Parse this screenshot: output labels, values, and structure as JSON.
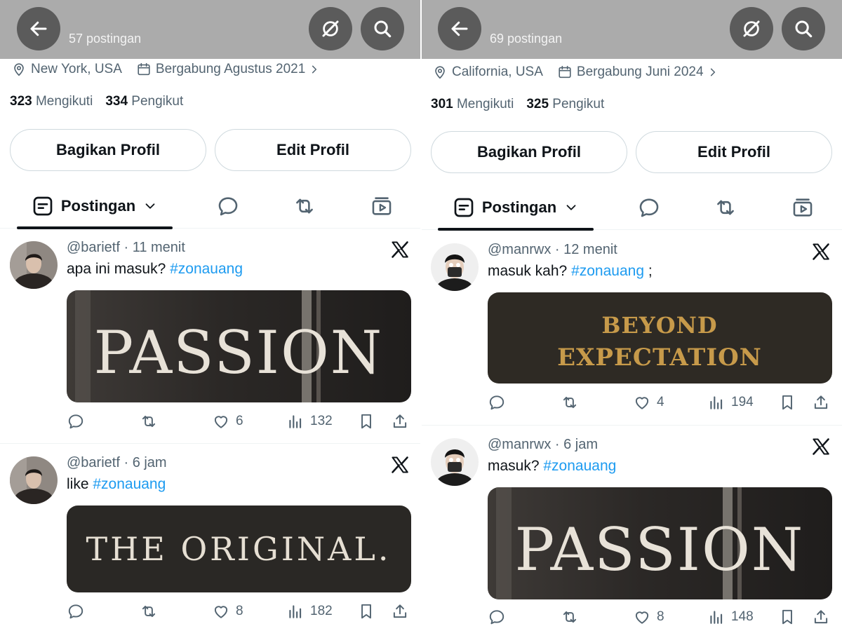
{
  "panels": [
    {
      "header": {
        "post_count": "57 postingan"
      },
      "profile": {
        "location": "New York, USA",
        "joined": "Bergabung Agustus 2021",
        "following_count": "323",
        "following_label": "Mengikuti",
        "followers_count": "334",
        "followers_label": "Pengikut"
      },
      "buttons": {
        "share": "Bagikan Profil",
        "edit": "Edit Profil"
      },
      "tabs": {
        "posts": "Postingan"
      },
      "posts": [
        {
          "handle": "@barietf",
          "sep": "·",
          "time": "11 menit",
          "text": "apa ini masuk? ",
          "hashtag": "#zonauang",
          "suffix": "",
          "image_text": "PASSION",
          "likes": "6",
          "views": "132"
        },
        {
          "handle": "@barietf",
          "sep": "·",
          "time": "6 jam",
          "text": "like ",
          "hashtag": "#zonauang",
          "suffix": "",
          "image_text": "THE ORIGINAL.",
          "likes": "8",
          "views": "182"
        }
      ]
    },
    {
      "header": {
        "post_count": "69 postingan"
      },
      "profile": {
        "location": "California, USA",
        "joined": "Bergabung Juni 2024",
        "following_count": "301",
        "following_label": "Mengikuti",
        "followers_count": "325",
        "followers_label": "Pengikut"
      },
      "buttons": {
        "share": "Bagikan Profil",
        "edit": "Edit Profil"
      },
      "tabs": {
        "posts": "Postingan"
      },
      "posts": [
        {
          "handle": "@manrwx",
          "sep": "·",
          "time": "12 menit",
          "text": "masuk kah? ",
          "hashtag": "#zonauang",
          "suffix": " ;",
          "image_text_1": "BEYOND",
          "image_text_2": "EXPECTATION",
          "likes": "4",
          "views": "194"
        },
        {
          "handle": "@manrwx",
          "sep": "·",
          "time": "6 jam",
          "text": "masuk? ",
          "hashtag": "#zonauang",
          "suffix": "",
          "image_text": "PASSION",
          "likes": "8",
          "views": "148"
        }
      ]
    }
  ],
  "colors": {
    "topbar": "#ababab",
    "button_dark": "#5b5b5b",
    "link": "#1d9bf0",
    "muted": "#536471",
    "text": "#0f1419"
  },
  "icons": [
    "back-arrow-icon",
    "grok-icon",
    "search-icon",
    "location-pin-icon",
    "calendar-icon",
    "chevron-right-icon",
    "posts-tab-icon",
    "chevron-down-icon",
    "reply-icon",
    "repost-icon",
    "like-icon",
    "views-icon",
    "bookmark-icon",
    "share-icon",
    "x-logo-icon"
  ]
}
